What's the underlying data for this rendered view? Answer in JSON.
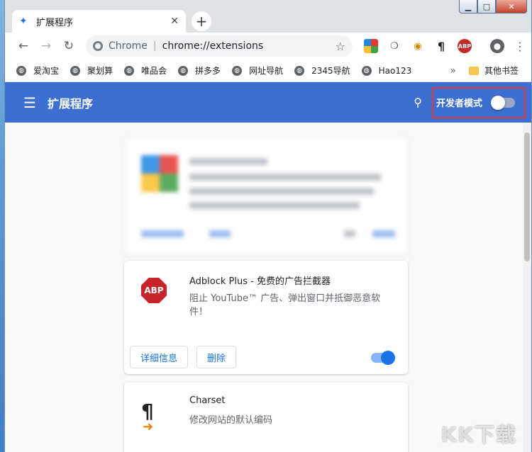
{
  "tab": {
    "title": "扩展程序",
    "close": "✕",
    "icon": "puzzle-icon"
  },
  "toolbar": {
    "back": "←",
    "forward": "→",
    "reload": "↻",
    "site": "Chrome",
    "url": "chrome://extensions",
    "star": "☆",
    "profile": "●",
    "menu": "⋮"
  },
  "bookmarks": {
    "items": [
      {
        "label": "爱淘宝"
      },
      {
        "label": "聚划算"
      },
      {
        "label": "唯品会"
      },
      {
        "label": "拼多多"
      },
      {
        "label": "网址导航"
      },
      {
        "label": "2345导航"
      },
      {
        "label": "Hao123"
      }
    ],
    "more": "»",
    "other": "其他书签"
  },
  "header": {
    "menu": "☰",
    "title": "扩展程序",
    "search": "🔍",
    "dev_mode_label": "开发者模式",
    "dev_mode_on": false
  },
  "extensions": [
    {
      "name": "Adblock Plus - 免费的广告拦截器",
      "description": "阻止 YouTube™ 广告、弹出窗口并抵御恶意软件！",
      "icon_text": "ABP",
      "details_label": "详细信息",
      "remove_label": "删除",
      "enabled": true
    },
    {
      "name": "Charset",
      "description": "修改网站的默认编码",
      "icon_text": "¶"
    }
  ],
  "watermark": "KK下载",
  "colors": {
    "header": "#3c6fd1",
    "accent": "#1a73e8",
    "abp": "#c8242b",
    "highlight": "#e53935"
  }
}
